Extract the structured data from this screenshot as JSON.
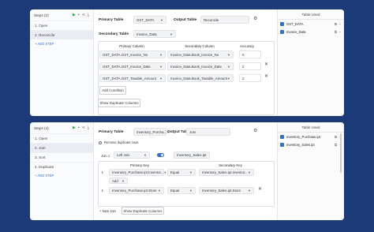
{
  "colors": {
    "background": "#1d3a78",
    "accent": "#2f6fd6",
    "run": "#2aa84a"
  },
  "panel1": {
    "steps_title": "Steps (2)",
    "steps": [
      "1. Open",
      "2. Reconcile"
    ],
    "add_step": "ADD STEP",
    "primary_table_label": "Primary Table",
    "primary_table_value": "GST_DATA",
    "output_table_label": "Output Table",
    "output_table_value": "Reconcile",
    "secondary_table_label": "Secondary Table",
    "secondary_table_value": "Invoice_Data",
    "col_primary": "Primary Column",
    "col_secondary": "Secondary Column",
    "col_accuracy": "Accuracy",
    "rows": [
      {
        "primary": "GST_DATA.GST_Invoice_No",
        "secondary": "Invoice_Data.Book_Invoice_No",
        "accuracy": "0"
      },
      {
        "primary": "GST_DATA.GST_Invoice_Date",
        "secondary": "Invoice_Data.Book_Invoice_Date",
        "accuracy": "2"
      },
      {
        "primary": "GST_DATA.GST_Taxable_Amount",
        "secondary": "Invoice_Data.Book_Taxable_Amount",
        "accuracy": "2"
      }
    ],
    "add_condition": "Add Condition",
    "show_duplicates": "Show Duplicate Columns",
    "tables_used_title": "Table Used",
    "tables_used": [
      "GST_DATA",
      "Invoice_Data"
    ]
  },
  "panel2": {
    "steps_title": "Steps (4)",
    "steps": [
      "1. Open",
      "2. Join",
      "3. Sort",
      "4. Duplicate"
    ],
    "add_step": "ADD STEP",
    "primary_table_label": "Primary Table",
    "primary_table_value": "Inventory_Purcha...",
    "output_table_label": "Output Table",
    "output_table_value": "Join",
    "remove_duplicate": "Remove duplicate rows",
    "join_label": "Join 1",
    "join_type": "Left Join",
    "join_table": "Inventory_Sales.ipt",
    "primary_key_label": "Primary Key",
    "secondary_key_label": "Secondary Key",
    "keys": [
      {
        "primary": "Inventory_Purchase.ipt.Inventor...",
        "op": "Equal",
        "secondary": "Inventory_Sales.ipt.Inventor..."
      },
      {
        "primary": "Inventory_Purchase.ipt.Store",
        "op": "Equal",
        "secondary": "Inventory_Sales.ipt.Store"
      }
    ],
    "add_key": "Add",
    "new_join": "+ New Join",
    "show_duplicates": "Show Duplicate Columns",
    "tables_used_title": "Table Used",
    "tables_used": [
      "Inventory_Purchase.ipt",
      "Inventory_Sales.ipt"
    ]
  }
}
